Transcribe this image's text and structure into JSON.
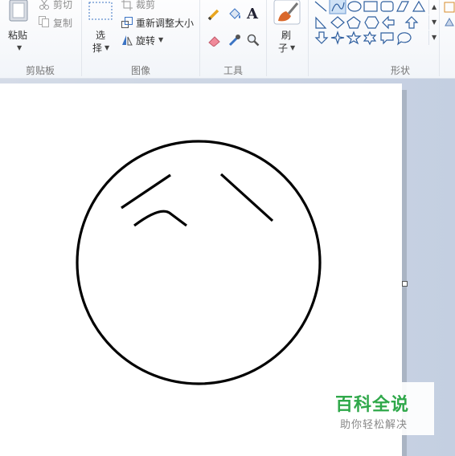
{
  "ribbon": {
    "clipboard": {
      "paste_label": "粘贴",
      "cut_label": "剪切",
      "copy_label": "复制",
      "group_label": "剪贴板"
    },
    "image": {
      "select_label_1": "选",
      "select_label_2": "择",
      "crop_label": "裁剪",
      "resize_label": "重新调整大小",
      "rotate_label": "旋转",
      "group_label": "图像"
    },
    "tools": {
      "text_tool_glyph": "A",
      "group_label": "工具"
    },
    "brushes": {
      "label_1": "刷",
      "label_2": "子",
      "group_label": ""
    },
    "shapes": {
      "group_label": "形状",
      "icons": [
        "line-icon",
        "curve-icon",
        "oval-icon",
        "rectangle-icon",
        "parallelogram-icon",
        "triangle-icon",
        "right-triangle-icon",
        "diamond-icon",
        "pentagon-icon",
        "hexagon-icon",
        "left-arrow-icon",
        "up-arrow-icon",
        "down-arrow-icon",
        "four-point-star-icon",
        "five-point-star-icon",
        "six-point-star-icon",
        "rounded-callout-icon",
        "oval-callout-icon"
      ]
    }
  },
  "watermark": {
    "title": "百科全说",
    "subtitle": "助你轻松解决"
  },
  "colors": {
    "brand_green": "#2fa84a",
    "canvas": "#ffffff",
    "stroke": "#000000"
  }
}
